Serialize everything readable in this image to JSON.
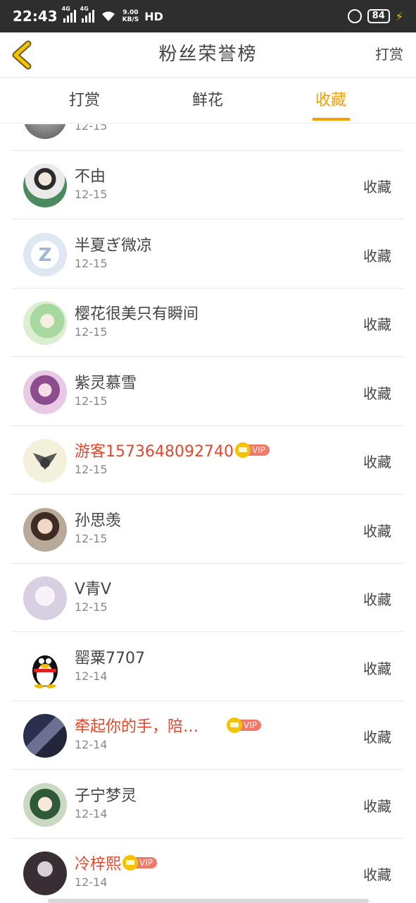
{
  "status_bar": {
    "time": "22:43",
    "signal1_tag": "4G",
    "signal2_tag": "4G",
    "speed_value": "9.00",
    "speed_unit": "KB/S",
    "hd": "HD",
    "battery": "84"
  },
  "header": {
    "title": "粉丝荣誉榜",
    "action_label": "打赏"
  },
  "tabs": [
    {
      "label": "打赏",
      "active": false
    },
    {
      "label": "鲜花",
      "active": false
    },
    {
      "label": "收藏",
      "active": true
    }
  ],
  "colors": {
    "accent": "#f5a000",
    "vip_name": "#e0492e",
    "status_bar_bg": "#2e2e2e"
  },
  "list": {
    "partial_row": {
      "date": "12-15"
    },
    "rows": [
      {
        "name": "不由",
        "date": "12-15",
        "action": "收藏",
        "vip": false,
        "avatar": "portrait-green"
      },
      {
        "name": "半夏ぎ微凉",
        "date": "12-15",
        "action": "收藏",
        "vip": false,
        "avatar": "qq-default-icon"
      },
      {
        "name": "樱花很美只有瞬间",
        "date": "12-15",
        "action": "收藏",
        "vip": false,
        "avatar": "anime-green-hair"
      },
      {
        "name": "紫灵慕雪",
        "date": "12-15",
        "action": "收藏",
        "vip": false,
        "avatar": "anime-purple"
      },
      {
        "name": "游客1573648092740",
        "date": "12-15",
        "action": "收藏",
        "vip": true,
        "vip_label": "VIP",
        "avatar": "bat-cartoon"
      },
      {
        "name": "孙思羡",
        "date": "12-15",
        "action": "收藏",
        "vip": false,
        "avatar": "photo-girl"
      },
      {
        "name": "V青V",
        "date": "12-15",
        "action": "收藏",
        "vip": false,
        "avatar": "photo-white-dress"
      },
      {
        "name": "罂粟7707",
        "date": "12-14",
        "action": "收藏",
        "vip": false,
        "avatar": "qq-penguin"
      },
      {
        "name": "牵起你的手，陪…",
        "date": "12-14",
        "action": "收藏",
        "vip": true,
        "vip_label": "VIP",
        "avatar": "couple-photo"
      },
      {
        "name": "子宁梦灵",
        "date": "12-14",
        "action": "收藏",
        "vip": false,
        "avatar": "anime-green"
      },
      {
        "name": "冷梓熙",
        "date": "12-14",
        "action": "收藏",
        "vip": true,
        "vip_label": "VIP",
        "avatar": "dark-photo"
      }
    ]
  }
}
